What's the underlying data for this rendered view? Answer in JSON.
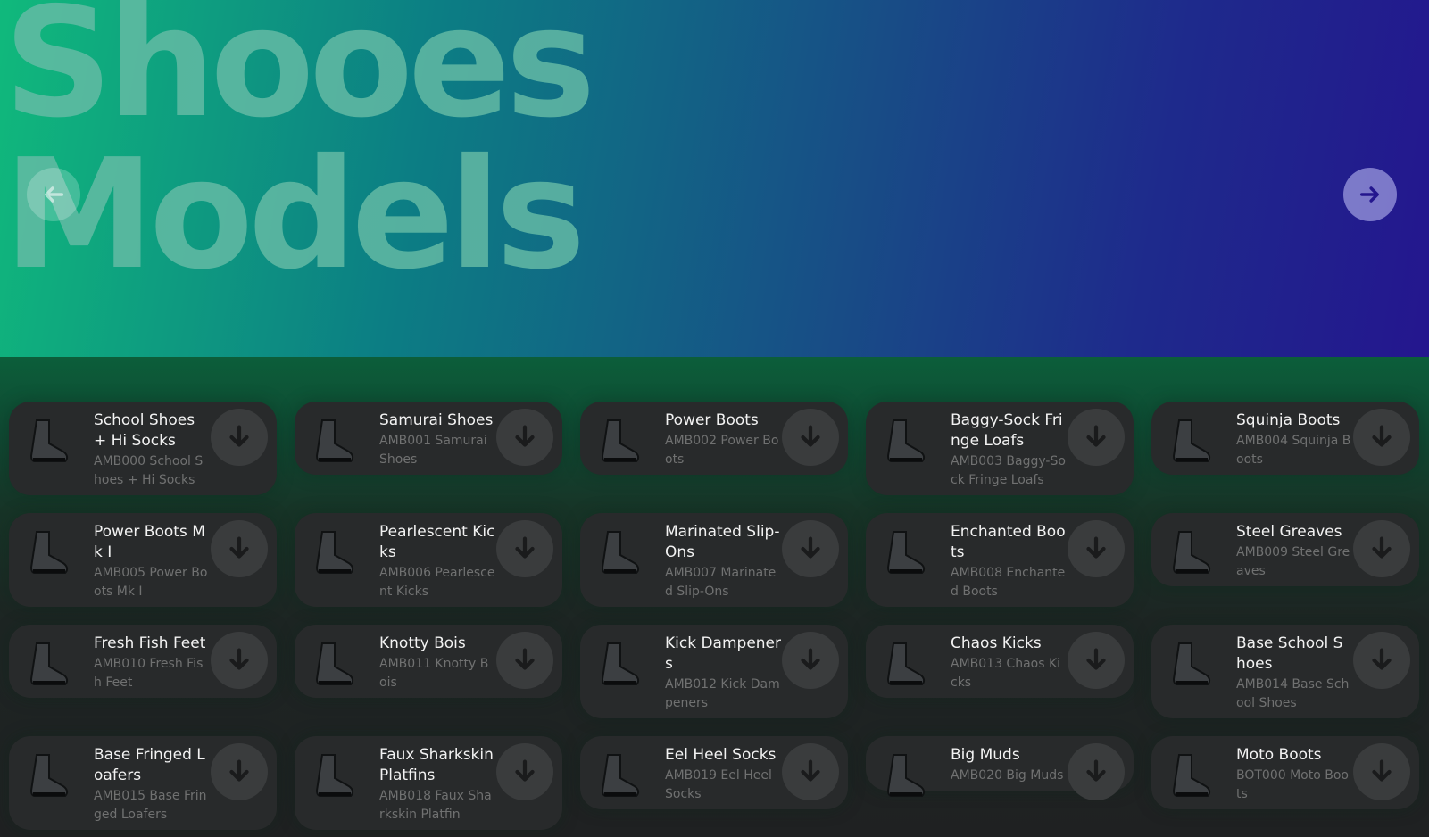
{
  "hero": {
    "title": "Shooes\nModels",
    "nav_prev_icon": "arrow-left-icon",
    "nav_next_icon": "arrow-right-icon"
  },
  "colors": {
    "hero_start": "#10b97c",
    "hero_end": "#24168e",
    "card_bg": "#282a2b",
    "download_button_bg": "#3a3c3d"
  },
  "items": [
    {
      "name": "School Shoes + Hi Socks",
      "code": "AMB000 School Shoes + Hi Socks",
      "icon": "shoe-thumbnail"
    },
    {
      "name": "Samurai Shoes",
      "code": "AMB001 Samurai Shoes",
      "icon": "shoe-thumbnail"
    },
    {
      "name": "Power Boots",
      "code": "AMB002 Power Boots",
      "icon": "shoe-thumbnail"
    },
    {
      "name": "Baggy-Sock Fringe Loafs",
      "code": "AMB003 Baggy-Sock Fringe Loafs",
      "icon": "shoe-thumbnail"
    },
    {
      "name": "Squinja Boots",
      "code": "AMB004 Squinja Boots",
      "icon": "shoe-thumbnail"
    },
    {
      "name": "Power Boots Mk I",
      "code": "AMB005 Power Boots Mk I",
      "icon": "shoe-thumbnail"
    },
    {
      "name": "Pearlescent Kicks",
      "code": "AMB006 Pearlescent Kicks",
      "icon": "shoe-thumbnail"
    },
    {
      "name": "Marinated Slip-Ons",
      "code": "AMB007 Marinated Slip-Ons",
      "icon": "shoe-thumbnail"
    },
    {
      "name": "Enchanted Boots",
      "code": "AMB008 Enchanted Boots",
      "icon": "shoe-thumbnail"
    },
    {
      "name": "Steel Greaves",
      "code": "AMB009 Steel Greaves",
      "icon": "shoe-thumbnail"
    },
    {
      "name": "Fresh Fish Feet",
      "code": "AMB010 Fresh Fish Feet",
      "icon": "shoe-thumbnail"
    },
    {
      "name": "Knotty Bois",
      "code": "AMB011 Knotty Bois",
      "icon": "shoe-thumbnail"
    },
    {
      "name": "Kick Dampeners",
      "code": "AMB012 Kick Dampeners",
      "icon": "shoe-thumbnail"
    },
    {
      "name": "Chaos Kicks",
      "code": "AMB013 Chaos Kicks",
      "icon": "shoe-thumbnail"
    },
    {
      "name": "Base School Shoes",
      "code": "AMB014 Base School Shoes",
      "icon": "shoe-thumbnail"
    },
    {
      "name": "Base Fringed Loafers",
      "code": "AMB015 Base Fringed Loafers",
      "icon": "shoe-thumbnail"
    },
    {
      "name": "Faux Sharkskin Platfins",
      "code": "AMB018 Faux Sharkskin Platfin",
      "icon": "shoe-thumbnail"
    },
    {
      "name": "Eel Heel Socks",
      "code": "AMB019 Eel Heel Socks",
      "icon": "shoe-thumbnail"
    },
    {
      "name": "Big Muds",
      "code": "AMB020 Big Muds",
      "icon": "shoe-thumbnail"
    },
    {
      "name": "Moto Boots",
      "code": "BOT000 Moto Boots",
      "icon": "shoe-thumbnail"
    }
  ],
  "download_icon": "arrow-down-icon"
}
